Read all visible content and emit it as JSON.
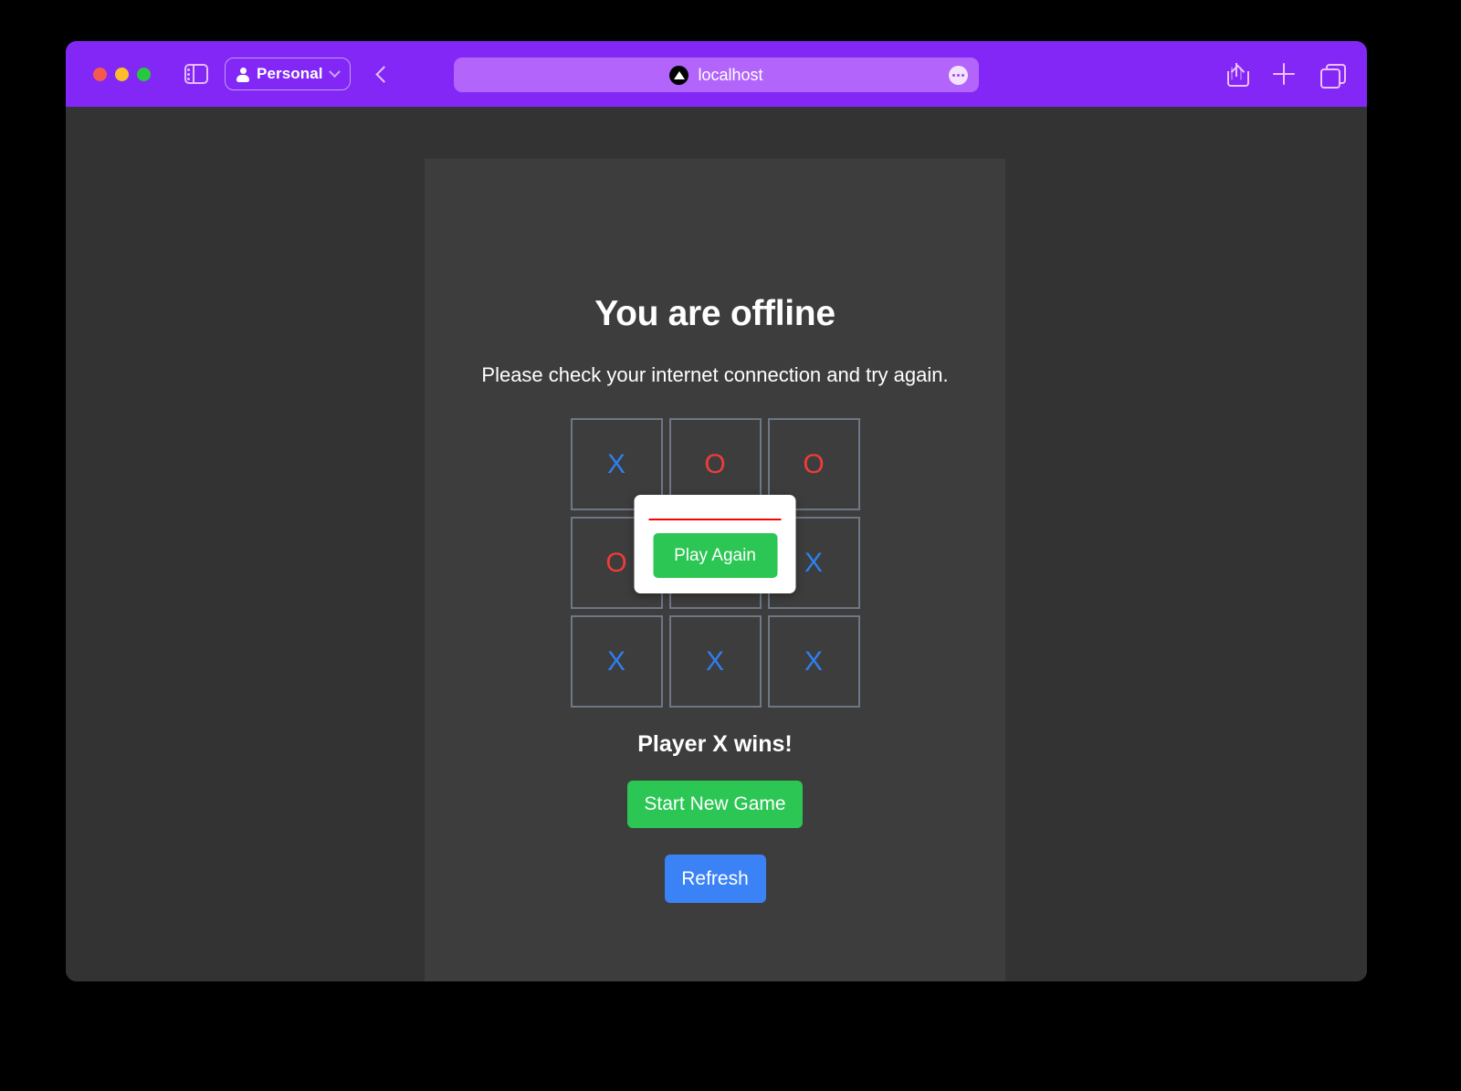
{
  "browser": {
    "traffic_lights": [
      {
        "name": "close",
        "color": "#f4594f"
      },
      {
        "name": "minimize",
        "color": "#fbbd2e"
      },
      {
        "name": "maximize",
        "color": "#27c83f"
      }
    ],
    "sidebar_toggle_icon": "sidebar-icon",
    "profile": {
      "icon": "person-icon",
      "label": "Personal",
      "chevron": "chevron-down-icon"
    },
    "back_icon": "chevron-left-icon",
    "urlbar": {
      "favicon": "triangle-in-circle-icon",
      "url": "localhost",
      "more_icon": "ellipsis-icon"
    },
    "right_icons": [
      {
        "name": "share-icon"
      },
      {
        "name": "plus-icon"
      },
      {
        "name": "tabs-icon"
      }
    ],
    "toolbar_color": "#8227f5",
    "urlbar_color": "#b264fb"
  },
  "page": {
    "title": "You are offline",
    "subtitle": "Please check your internet connection and try again.",
    "status": "Player X wins!",
    "new_game_label": "Start New Game",
    "refresh_label": "Refresh",
    "background": "#3d3d3d",
    "accent_green": "#2bc653",
    "accent_blue": "#3b82f6"
  },
  "modal": {
    "divider_color": "#ff0000",
    "play_again_label": "Play Again"
  },
  "board": {
    "cells": [
      {
        "mark": "X",
        "player": "x"
      },
      {
        "mark": "O",
        "player": "o"
      },
      {
        "mark": "O",
        "player": "o"
      },
      {
        "mark": "O",
        "player": "o"
      },
      {
        "mark": "",
        "player": "empty"
      },
      {
        "mark": "X",
        "player": "x"
      },
      {
        "mark": "X",
        "player": "x"
      },
      {
        "mark": "X",
        "player": "x"
      },
      {
        "mark": "X",
        "player": "x"
      }
    ],
    "x_color": "#2f7ff0",
    "o_color": "#f03b3b",
    "cell_border": "#6e7785"
  }
}
